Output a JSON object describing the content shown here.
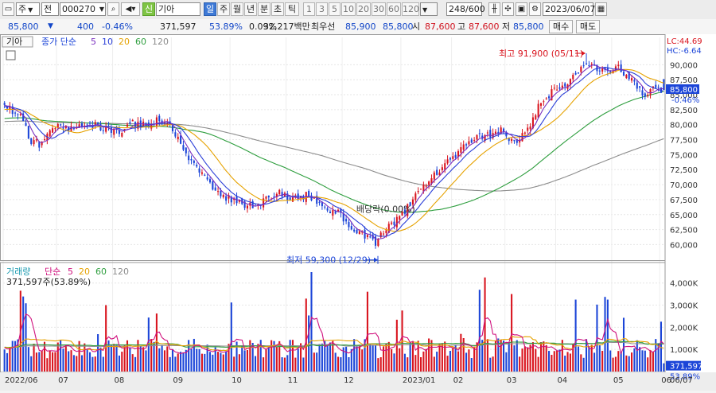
{
  "toolbar": {
    "code_type": "주",
    "code_mode": "전",
    "stock_code": "000270",
    "credit_badge": "신",
    "stock_name": "기아",
    "periods": [
      {
        "label": "일",
        "active": true
      },
      {
        "label": "주",
        "active": false
      },
      {
        "label": "월",
        "active": false
      },
      {
        "label": "년",
        "active": false
      },
      {
        "label": "분",
        "active": false
      },
      {
        "label": "초",
        "active": false
      },
      {
        "label": "틱",
        "active": false
      }
    ],
    "intervals": [
      "1",
      "3",
      "5",
      "10",
      "20",
      "30",
      "60",
      "120"
    ],
    "count": "248/600",
    "date": "2023/06/07"
  },
  "info": {
    "price": "85,800",
    "change": "400",
    "change_pct": "-0.46%",
    "volume": "371,597",
    "vol_ratio": "53.89%",
    "turnover": "0.09%",
    "amount": "32,217백만",
    "best_label": "최우선",
    "ask": "85,900",
    "bid": "85,800",
    "open_label": "시",
    "open": "87,600",
    "high_label": "고",
    "high": "87,600",
    "low_label": "저",
    "low": "85,800",
    "buy_label": "매수",
    "sell_label": "매도"
  },
  "price_panel": {
    "name_tag": "기아",
    "legend_prefix": "종가 단순",
    "ma_labels": [
      {
        "label": "5",
        "color": "#7a2fbf"
      },
      {
        "label": "10",
        "color": "#2b3fd8"
      },
      {
        "label": "20",
        "color": "#e6a200"
      },
      {
        "label": "60",
        "color": "#2e9e3e"
      },
      {
        "label": "120",
        "color": "#8c8c8c"
      }
    ],
    "lc": "LC:44.69",
    "hc": "HC:-6.64",
    "current_price": "85,800",
    "current_change": "-0.46%",
    "high_annotation": "최고 91,900 (05/11)",
    "low_annotation": "최저 59,300 (12/29)",
    "dividend_annotation": "배당락(0.00%)"
  },
  "volume_panel": {
    "title": "거래량",
    "legend_prefix": "단순",
    "ma_labels": [
      {
        "label": "5",
        "color": "#d0117e"
      },
      {
        "label": "20",
        "color": "#e6a200"
      },
      {
        "label": "60",
        "color": "#2e9e3e"
      },
      {
        "label": "120",
        "color": "#8c8c8c"
      }
    ],
    "value_text": "371,597주(53.89%)",
    "current_value": "371,597",
    "current_pct": "53.89%"
  },
  "colors": {
    "up": "#d9141e",
    "down": "#1c45d8",
    "ma5": "#7a2fbf",
    "ma10": "#2b3fd8",
    "ma20": "#e6a200",
    "ma60": "#2e9e3e",
    "ma120": "#8c8c8c"
  },
  "chart_data": {
    "type": "candlestick",
    "y_ticks": [
      "90,000",
      "87,500",
      "85,000",
      "82,500",
      "80,000",
      "77,500",
      "75,000",
      "72,500",
      "70,000",
      "67,500",
      "65,000",
      "62,500",
      "60,000"
    ],
    "ylim": [
      58200,
      92700
    ],
    "volume_ticks": [
      "4,000K",
      "3,000K",
      "2,000K",
      "1,000K"
    ],
    "volume_ylim": [
      0,
      4600000
    ],
    "x_labels": [
      "2022/06",
      "07",
      "08",
      "09",
      "10",
      "11",
      "12",
      "2023/01",
      "02",
      "03",
      "04",
      "05",
      "06",
      "06/07"
    ],
    "bars": 248,
    "close_anchors": [
      [
        0,
        83300
      ],
      [
        6,
        81200
      ],
      [
        10,
        77200
      ],
      [
        14,
        76700
      ],
      [
        20,
        80400
      ],
      [
        24,
        79100
      ],
      [
        30,
        80200
      ],
      [
        36,
        79600
      ],
      [
        44,
        78700
      ],
      [
        48,
        80200
      ],
      [
        54,
        79800
      ],
      [
        58,
        80900
      ],
      [
        62,
        79800
      ],
      [
        66,
        76700
      ],
      [
        70,
        73800
      ],
      [
        76,
        70400
      ],
      [
        82,
        68100
      ],
      [
        88,
        66900
      ],
      [
        94,
        66500
      ],
      [
        102,
        68900
      ],
      [
        108,
        67600
      ],
      [
        114,
        68400
      ],
      [
        120,
        66000
      ],
      [
        126,
        65100
      ],
      [
        130,
        62600
      ],
      [
        134,
        62000
      ],
      [
        139,
        60200
      ],
      [
        143,
        62900
      ],
      [
        148,
        64400
      ],
      [
        152,
        66800
      ],
      [
        157,
        70000
      ],
      [
        162,
        72200
      ],
      [
        168,
        74300
      ],
      [
        174,
        77300
      ],
      [
        180,
        78200
      ],
      [
        186,
        78900
      ],
      [
        191,
        76700
      ],
      [
        196,
        78900
      ],
      [
        200,
        83100
      ],
      [
        206,
        86000
      ],
      [
        212,
        87200
      ],
      [
        218,
        90400
      ],
      [
        224,
        89000
      ],
      [
        230,
        89500
      ],
      [
        236,
        86700
      ],
      [
        240,
        84400
      ],
      [
        244,
        86200
      ],
      [
        247,
        85800
      ]
    ],
    "high": {
      "value": 91900,
      "date": "05/11"
    },
    "low": {
      "value": 59300,
      "date": "12/29"
    },
    "last": {
      "close": 85800,
      "volume": 371597
    }
  }
}
